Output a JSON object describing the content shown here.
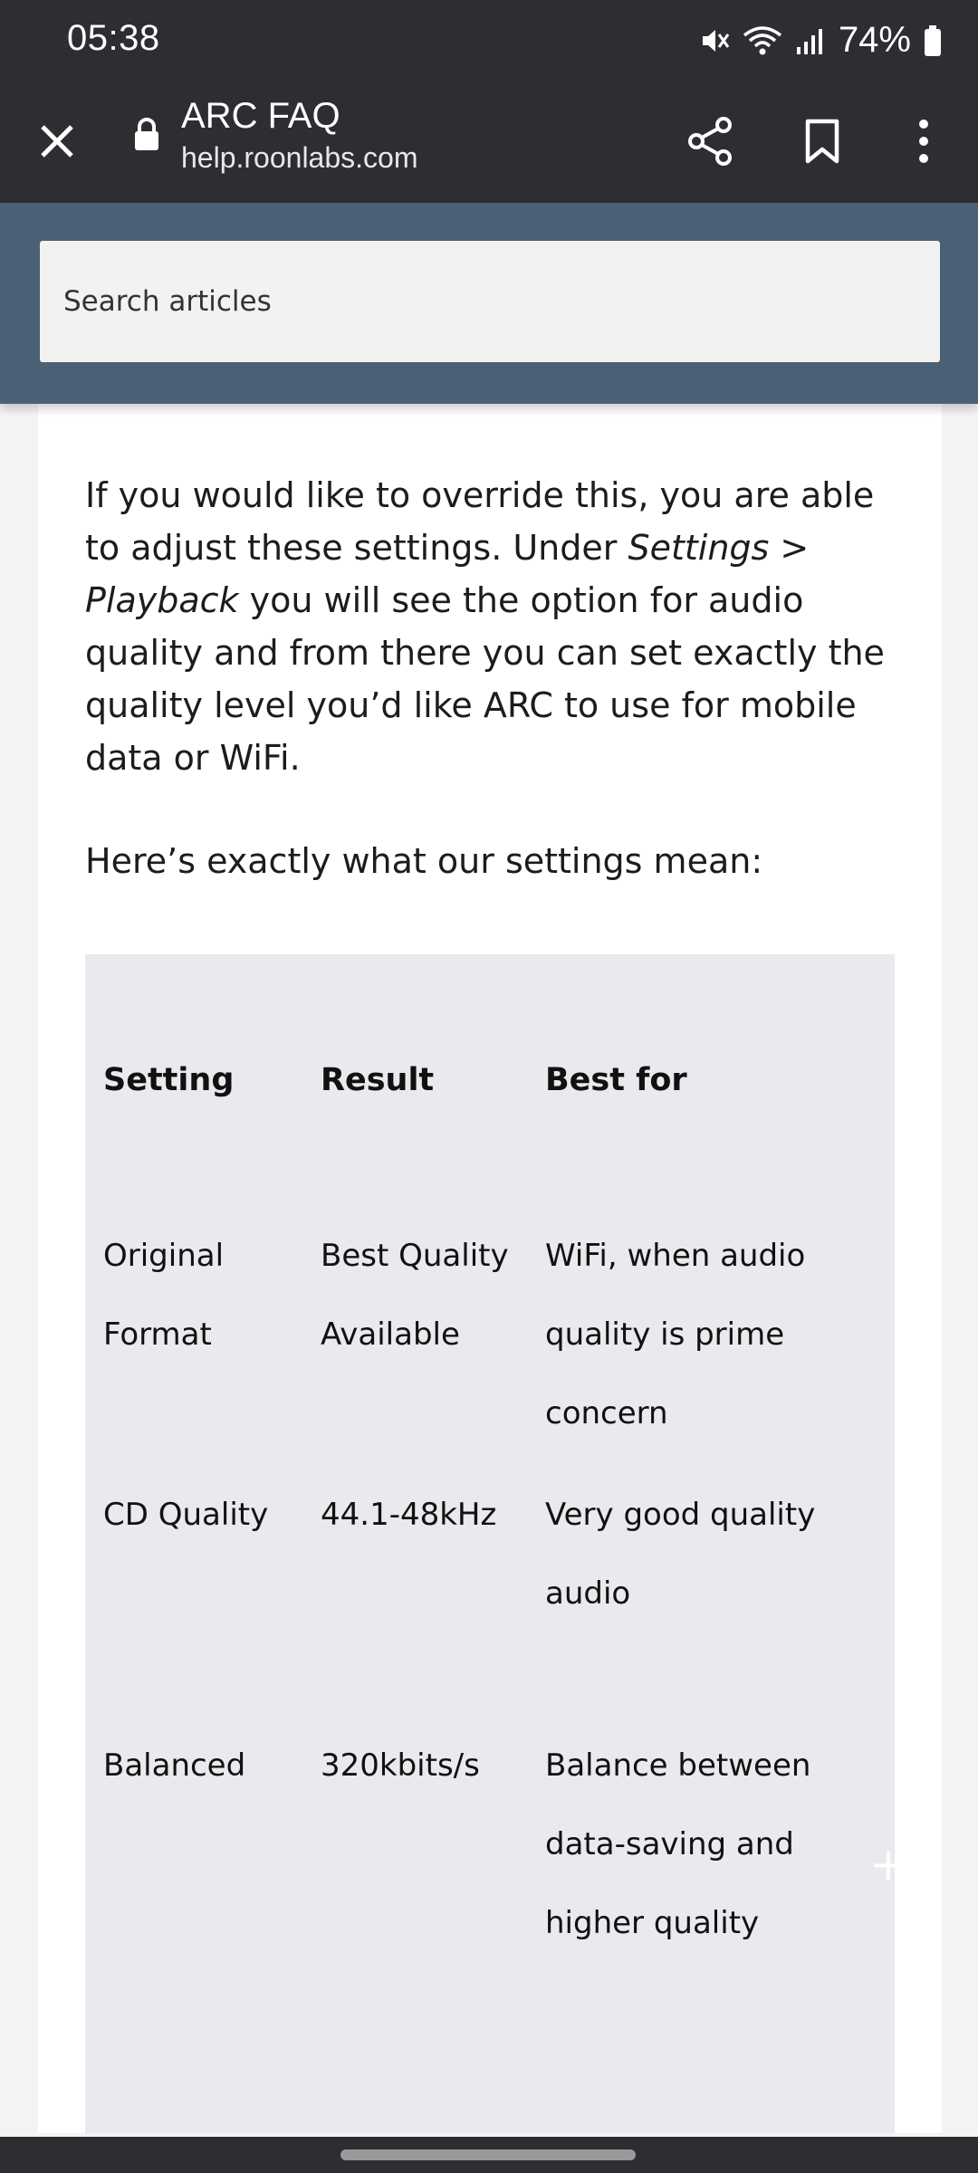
{
  "status_bar": {
    "time": "05:38",
    "battery": "74%",
    "icons": [
      "mute-icon",
      "wifi-icon",
      "signal-icon",
      "battery-icon"
    ]
  },
  "toolbar": {
    "title": "ARC FAQ",
    "url": "help.roonlabs.com",
    "icons": [
      "close-icon",
      "lock-icon",
      "share-icon",
      "bookmark-icon",
      "more-vert-icon"
    ]
  },
  "search": {
    "placeholder": "Search articles"
  },
  "article": {
    "para1": {
      "t1": "If you would like to override this, you are able to adjust these settings. Under ",
      "em1": "Settings > Playback",
      "t2": " you will see the option for audio quality and from there you can set exactly the quality level you’d like ARC to use for mobile data or WiFi."
    },
    "para2": "Here’s exactly what our settings mean:",
    "table": {
      "headers": [
        "Setting",
        "Result",
        "Best for"
      ],
      "rows": [
        [
          "Original Format",
          "Best Quality Available",
          "WiFi, when audio quality is prime concern"
        ],
        [
          "CD Quality",
          "44.1-48kHz",
          "Very good quality audio"
        ],
        [
          "Balanced",
          "320kbits/s",
          "Balance between data-saving and higher quality"
        ]
      ]
    }
  },
  "colors": {
    "chrome": "#2d2e31",
    "header": "#4a6175",
    "table_bg": "#e9eaed"
  }
}
